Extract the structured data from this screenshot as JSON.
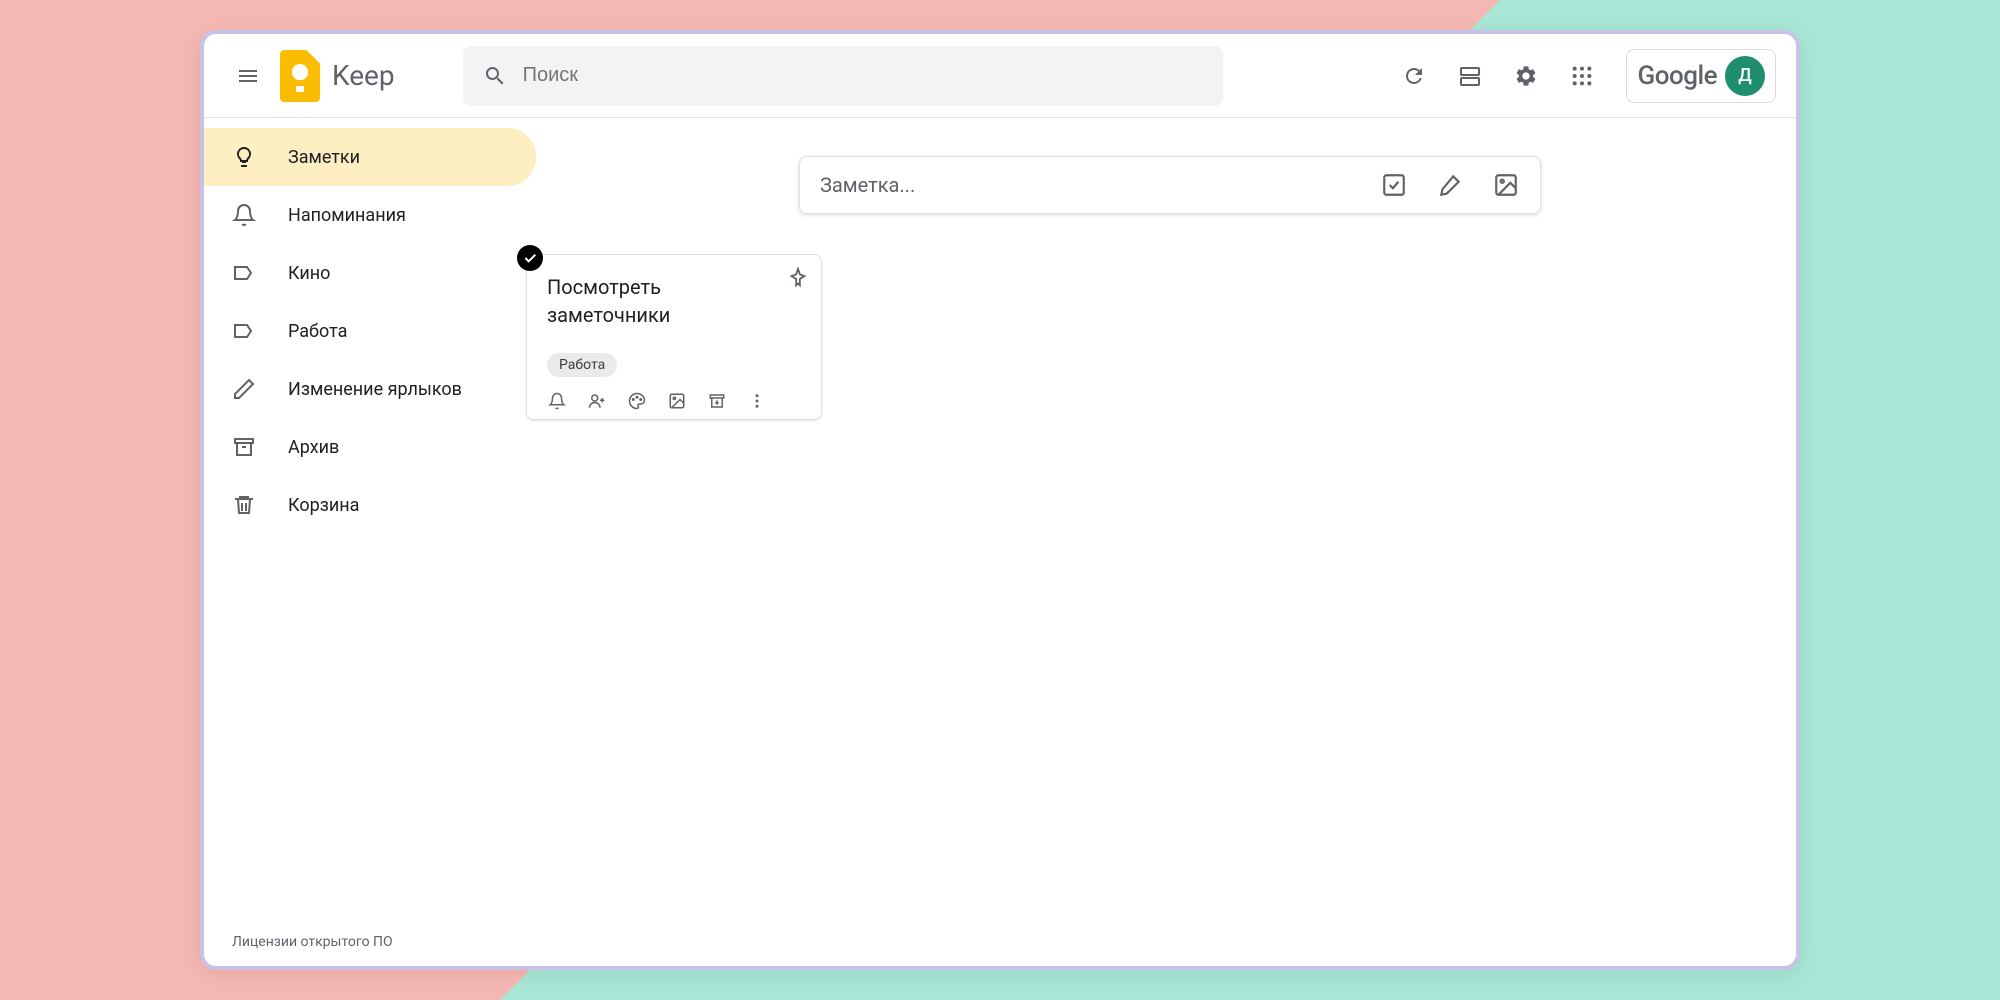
{
  "header": {
    "app_title": "Keep",
    "search_placeholder": "Поиск",
    "google_label": "Google",
    "avatar_initial": "Д"
  },
  "sidebar": {
    "items": [
      {
        "label": "Заметки",
        "icon": "lightbulb"
      },
      {
        "label": "Напоминания",
        "icon": "bell"
      },
      {
        "label": "Кино",
        "icon": "label"
      },
      {
        "label": "Работа",
        "icon": "label"
      },
      {
        "label": "Изменение ярлыков",
        "icon": "pencil"
      },
      {
        "label": "Архив",
        "icon": "archive"
      },
      {
        "label": "Корзина",
        "icon": "trash"
      }
    ]
  },
  "compose": {
    "placeholder": "Заметка..."
  },
  "note": {
    "title": "Посмотреть заметочники",
    "label": "Работа"
  },
  "footer": {
    "text": "Лицензии открытого ПО"
  }
}
